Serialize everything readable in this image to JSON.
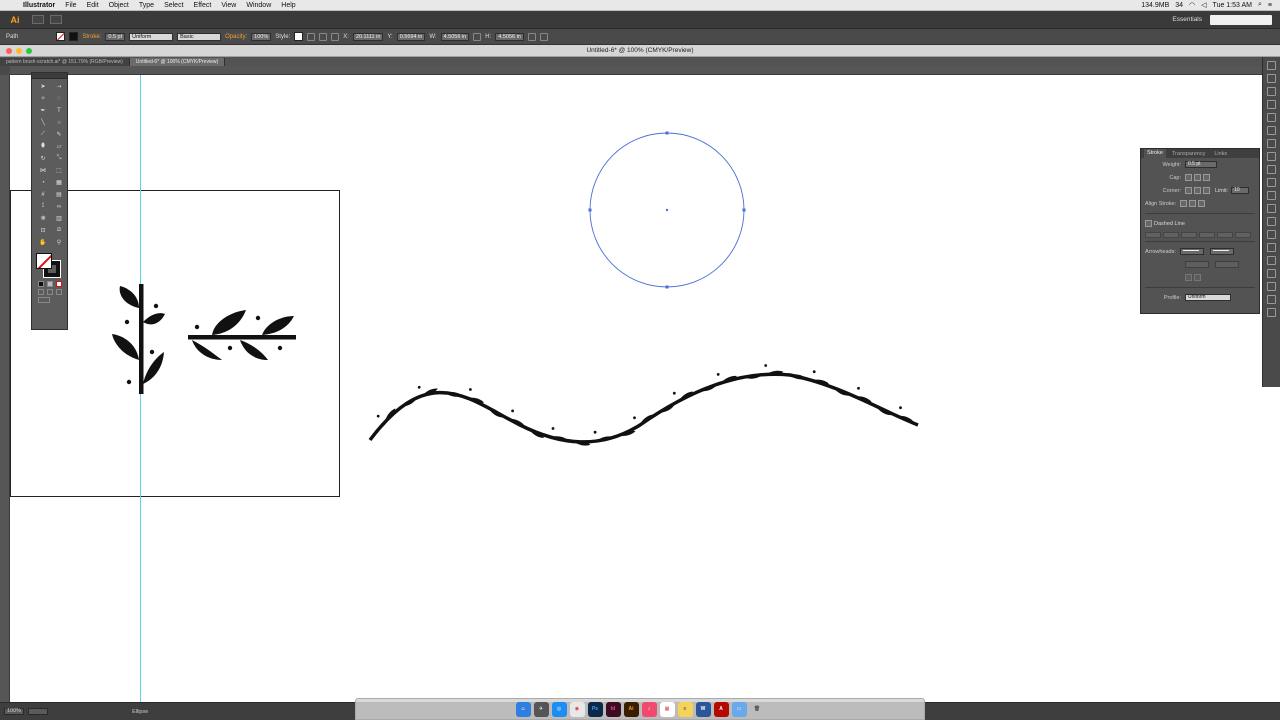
{
  "menubar": {
    "app_name": "Illustrator",
    "items": [
      "File",
      "Edit",
      "Object",
      "Type",
      "Select",
      "Effect",
      "View",
      "Window",
      "Help"
    ],
    "status_memory": "134.9MB",
    "status_count": "34",
    "clock": "Tue 1:53 AM"
  },
  "appbar": {
    "logo": "Ai",
    "workspace": "Essentials"
  },
  "control_bar": {
    "selection_type": "Path",
    "stroke_label": "Stroke:",
    "stroke_weight": "0.5 pt",
    "profile": "Uniform",
    "brush": "Basic",
    "opacity_label": "Opacity:",
    "opacity_value": "100%",
    "style_label": "Style:",
    "x_value": "20.1111 in",
    "y_value": "0.5694 in",
    "w_value": "4.5056 in",
    "h_value": "4.5056 in"
  },
  "titlebar": {
    "document_title": "Untitled-6* @ 100% (CMYK/Preview)"
  },
  "tabs": [
    {
      "label": "pattern brush-scratch.ai* @ 151.79% (RGB/Preview)",
      "active": false
    },
    {
      "label": "Untitled-6* @ 100% (CMYK/Preview)",
      "active": true
    }
  ],
  "stroke_panel": {
    "tabs": [
      "Stroke",
      "Transparency",
      "Links"
    ],
    "weight_label": "Weight:",
    "weight_value": "0.5 pt",
    "cap_label": "Cap:",
    "corner_label": "Corner:",
    "limit_label": "Limit:",
    "limit_value": "10",
    "align_label": "Align Stroke:",
    "dashed_label": "Dashed Line",
    "arrowheads_label": "Arrowheads:",
    "profile_label": "Profile:",
    "profile_value": "Uniform"
  },
  "statusbar": {
    "zoom": "100%",
    "tool_name": "Ellipse"
  },
  "colors": {
    "accent_orange": "#f7a21b",
    "guide_cyan": "#5ad4e6",
    "selection_blue": "#4a6fd8"
  },
  "dock_icons": [
    "finder-icon",
    "launchpad-icon",
    "safari-icon",
    "chrome-icon",
    "photoshop-icon",
    "indesign-icon",
    "illustrator-icon",
    "itunes-icon",
    "calendar-icon",
    "notes-icon",
    "word-icon",
    "acrobat-icon",
    "folder-icon",
    "trash-icon"
  ]
}
